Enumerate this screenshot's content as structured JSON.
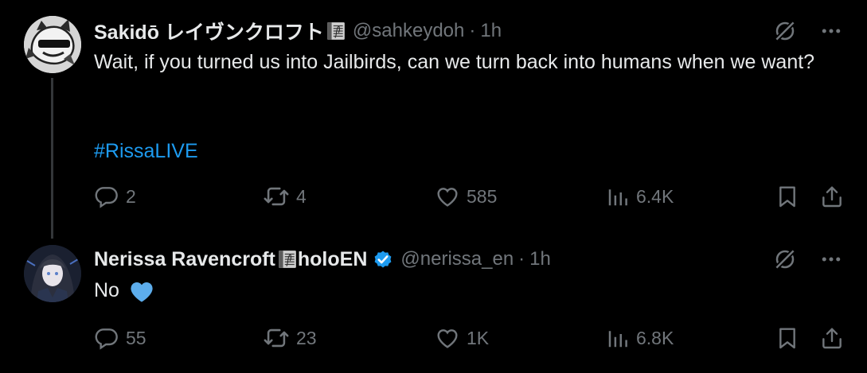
{
  "colors": {
    "background": "#000000",
    "text": "#e7e9ea",
    "muted": "#71767b",
    "link": "#1d9bf0",
    "verified": "#1d9bf0",
    "heart_emoji": "#5dadec"
  },
  "tweets": [
    {
      "display_name": "Sakidō レイヴンクロフト",
      "name_emoji_icon": "ledger-book-icon",
      "handle": "@sahkeydoh",
      "dot": "·",
      "time": "1h",
      "text": "Wait, if you turned us into Jailbirds, can we turn back into humans when we want?",
      "hashtag": "#RissaLIVE",
      "counts": {
        "reply": "2",
        "retweet": "4",
        "like": "585",
        "views": "6.4K"
      }
    },
    {
      "display_name": "Nerissa Ravencroft",
      "name_emoji_icon": "ledger-book-icon",
      "name_suffix": "holoEN",
      "verified": true,
      "handle": "@nerissa_en",
      "dot": "·",
      "time": "1h",
      "text": "No",
      "text_emoji_icon": "blue-heart-icon",
      "counts": {
        "reply": "55",
        "retweet": "23",
        "like": "1K",
        "views": "6.8K"
      }
    }
  ]
}
